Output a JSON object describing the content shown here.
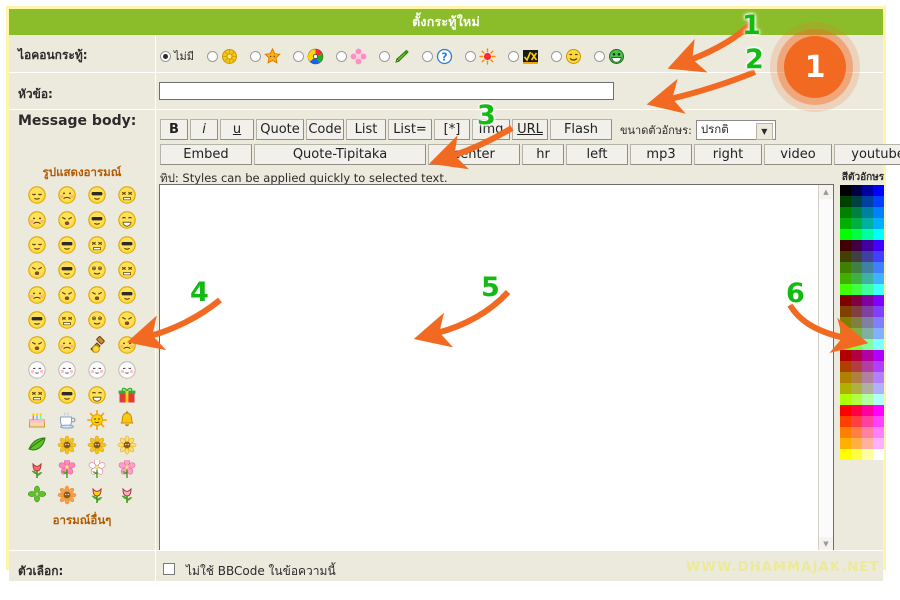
{
  "window": {
    "title": "ตั้งกระทู้ใหม่",
    "frame_color": "#fdf5a8",
    "header_color": "#8bbd2b",
    "body_color": "#ece9dd"
  },
  "form": {
    "icon_row": {
      "label": "ไอคอนกระทู้:",
      "options": [
        {
          "name": "none",
          "text": "ไม่มี",
          "selected": true,
          "icon": "none"
        },
        {
          "name": "flower-gear",
          "text": "",
          "selected": false,
          "icon": "yellow-flower-icon"
        },
        {
          "name": "star",
          "text": "",
          "selected": false,
          "icon": "orange-star-icon"
        },
        {
          "name": "colorwheel",
          "text": "",
          "selected": false,
          "icon": "color-wheel-icon"
        },
        {
          "name": "pink-flower",
          "text": "",
          "selected": false,
          "icon": "pink-flower-icon"
        },
        {
          "name": "pen",
          "text": "",
          "selected": false,
          "icon": "green-pen-icon"
        },
        {
          "name": "question",
          "text": "",
          "selected": false,
          "icon": "question-mark-icon"
        },
        {
          "name": "red-sun",
          "text": "",
          "selected": false,
          "icon": "red-sun-icon"
        },
        {
          "name": "check-cross",
          "text": "",
          "selected": false,
          "icon": "check-cross-icon"
        },
        {
          "name": "yellow-smile",
          "text": "",
          "selected": false,
          "icon": "yellow-smiley-icon"
        },
        {
          "name": "green-smile",
          "text": "",
          "selected": false,
          "icon": "green-smiley-icon"
        }
      ]
    },
    "subject_row": {
      "label": "หัวข้อ:",
      "value": "",
      "placeholder": ""
    },
    "body_row": {
      "label": "Message body:",
      "tip": "ทิป: Styles can be applied quickly to selected text.",
      "textarea_value": ""
    },
    "options_row": {
      "label": "ตัวเลือก:",
      "checkbox_label": "ไม่ใช้ BBCode ในข้อความนี้",
      "checked": false
    }
  },
  "toolbar": {
    "row1": [
      "B",
      "i",
      "u",
      "Quote",
      "Code",
      "List",
      "List=",
      "[*]",
      "Img",
      "URL",
      "Flash"
    ],
    "row2": [
      "Embed",
      "Quote-Tipitaka",
      "center",
      "hr",
      "left",
      "mp3",
      "right",
      "video",
      "youtube"
    ],
    "fontsize_label": "ขนาดตัวอักษร:",
    "fontsize_value": "ปรกติ",
    "fontsize_options": [
      "ปรกติ"
    ]
  },
  "smilies": {
    "header": "รูปแสดงอารมณ์",
    "footer": "อารมณ์อื่นๆ",
    "rows": 13,
    "cols": 4,
    "items": [
      "smiley-roll-eyes",
      "smiley-grin",
      "smiley-smirk",
      "smiley-scream",
      "smiley-kiss",
      "smiley-shy",
      "smiley-peace",
      "smiley-big-eyes",
      "smiley-surprised",
      "smiley-dizzy",
      "smiley-wonder",
      "smiley-shush",
      "smiley-cry",
      "smiley-angry",
      "smiley-whistle",
      "smiley-giggle",
      "smiley-wink",
      "smiley-sad",
      "smiley-sunglasses",
      "smiley-teeth",
      "smiley-blush",
      "smiley-x-eyes",
      "smiley-vampire",
      "smiley-swirl-eyes",
      "smiley-sweat-drop",
      "smiley-flushed-red",
      "smiley-gavel",
      "smiley-calm",
      "smiley-white-1",
      "smiley-white-2",
      "smiley-white-3",
      "smiley-white-4",
      "smiley-tongue",
      "smiley-sleep",
      "smiley-thinking",
      "gift-icon",
      "birthday-cake-icon",
      "teacup-icon",
      "sun-icon",
      "bell-icon",
      "leaf-icon",
      "yellow-flower-icon",
      "sunflower-icon",
      "sparkle-flower-icon",
      "tulip-icon",
      "pink-flower-icon",
      "white-flower-icon",
      "pink-blossom-icon",
      "green-clover-icon",
      "orange-flower-icon",
      "yellow-tulip-icon",
      "pink-tulip-icon"
    ]
  },
  "palette": {
    "header": "สีตัวอักษร",
    "cols": 4,
    "colors": [
      "#000000",
      "#000040",
      "#0000a0",
      "#0000ff",
      "#004000",
      "#004040",
      "#0040a0",
      "#0040ff",
      "#008000",
      "#008040",
      "#0080a0",
      "#0080ff",
      "#00b000",
      "#00b040",
      "#00b0a0",
      "#00b0ff",
      "#00ff00",
      "#00ff40",
      "#00ffa0",
      "#00ffff",
      "#400000",
      "#400040",
      "#4000a0",
      "#4000ff",
      "#404000",
      "#404040",
      "#4040a0",
      "#4040ff",
      "#408000",
      "#408040",
      "#4080a0",
      "#4080ff",
      "#40b000",
      "#40b040",
      "#40b0a0",
      "#40b0ff",
      "#40ff00",
      "#40ff40",
      "#40ffa0",
      "#40ffff",
      "#800000",
      "#800040",
      "#8000a0",
      "#8000ff",
      "#804000",
      "#804040",
      "#8040a0",
      "#8040ff",
      "#808000",
      "#808040",
      "#8080a0",
      "#8080ff",
      "#80b000",
      "#80b040",
      "#80b0a0",
      "#80b0ff",
      "#80ff00",
      "#80ff40",
      "#80ffa0",
      "#80ffff",
      "#b00000",
      "#b00040",
      "#b000a0",
      "#b000ff",
      "#b04000",
      "#b04040",
      "#b040a0",
      "#b040ff",
      "#b08000",
      "#b08040",
      "#b080a0",
      "#b080ff",
      "#b0b000",
      "#b0b040",
      "#b0b0a0",
      "#b0b0ff",
      "#b0ff00",
      "#b0ff40",
      "#b0ffa0",
      "#b0ffff",
      "#ff0000",
      "#ff0040",
      "#ff00a0",
      "#ff00ff",
      "#ff4000",
      "#ff4040",
      "#ff40a0",
      "#ff40ff",
      "#ff8000",
      "#ff8040",
      "#ff80a0",
      "#ff80ff",
      "#ffb000",
      "#ffb040",
      "#ffb0a0",
      "#ffb0ff",
      "#ffff00",
      "#ffff40",
      "#ffffa0",
      "#ffffff"
    ]
  },
  "annotations": {
    "numbers": [
      "1",
      "2",
      "3",
      "4",
      "5",
      "6"
    ],
    "badge": "1",
    "number_color": "#12bb12",
    "arrow_color": "#f26a21"
  },
  "watermark": "WWW.DHAMMAJAK.NET"
}
